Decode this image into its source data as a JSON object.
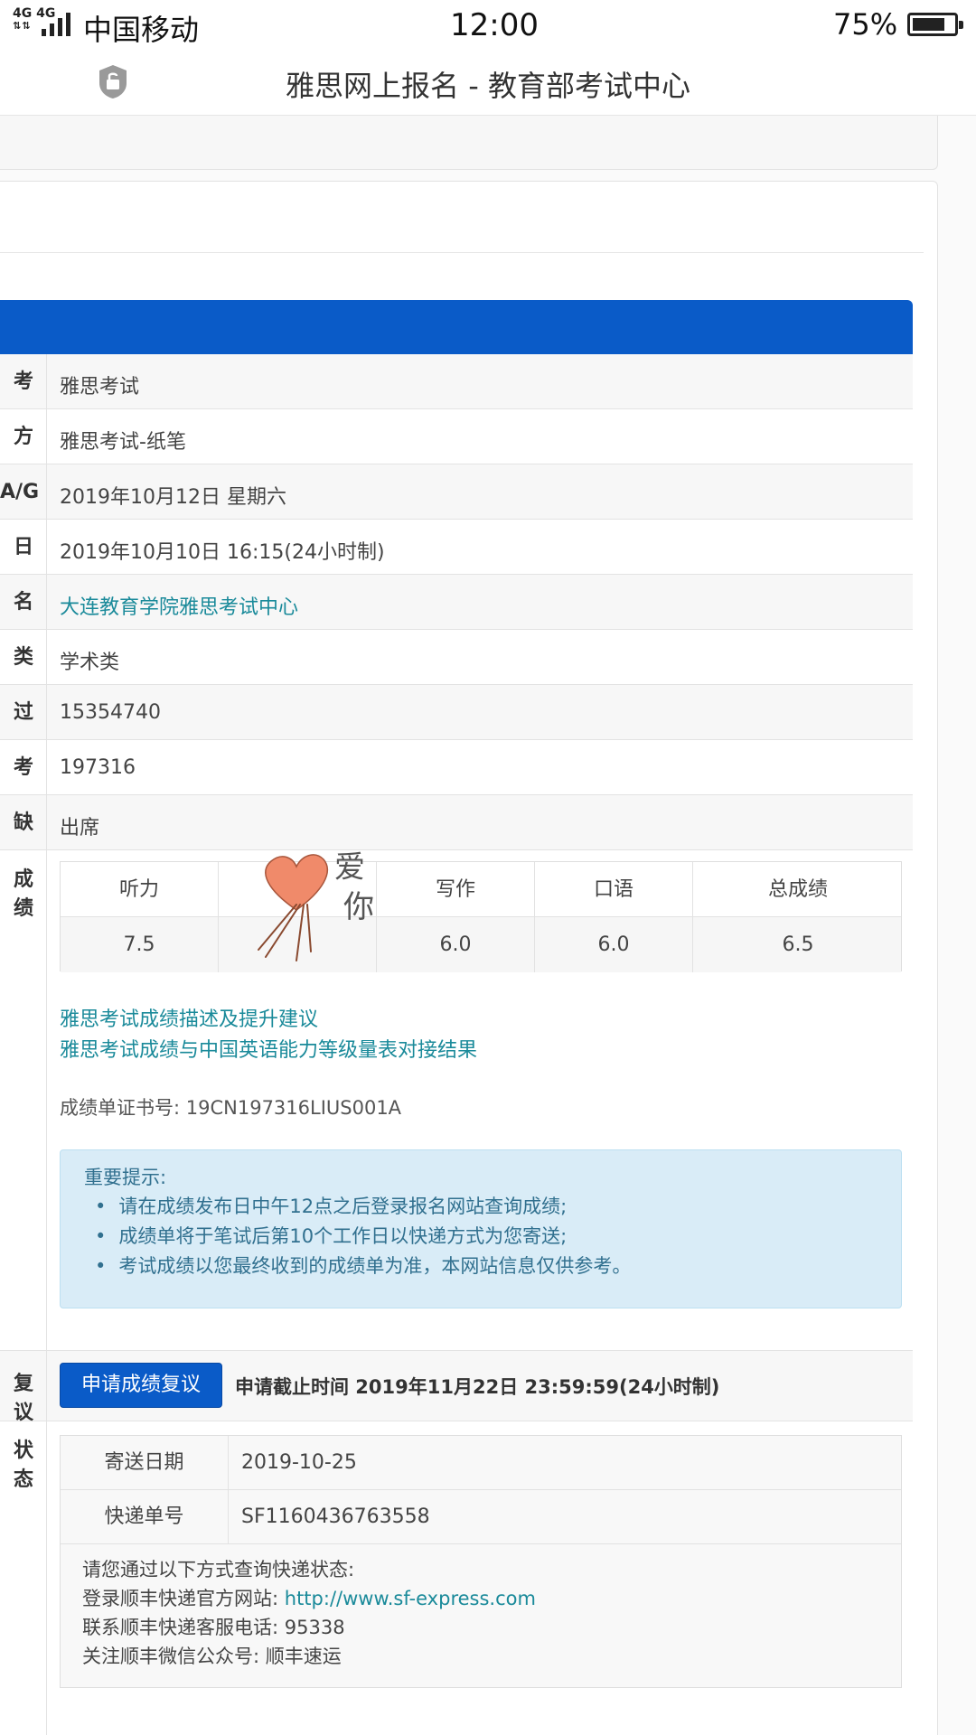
{
  "status_bar": {
    "network": "4G 4G",
    "carrier": "中国移动",
    "time": "12:00",
    "battery": "75%"
  },
  "nav": {
    "title": "雅思网上报名 - 教育部考试中心",
    "lock_icon": "lock-icon"
  },
  "details": [
    {
      "label": "考试",
      "value": "雅思考试"
    },
    {
      "label": "方式",
      "value": "雅思考试-纸笔"
    },
    {
      "label": "A/G",
      "value": "2019年10月12日 星期六"
    },
    {
      "label": "日期",
      "value": "2019年10月10日 16:15(24小时制)"
    },
    {
      "label": "名称",
      "value": "大连教育学院雅思考试中心"
    },
    {
      "label": "类型",
      "value": "学术类"
    },
    {
      "label": "过程)",
      "value": "15354740"
    },
    {
      "label": "考号",
      "value": "197316"
    },
    {
      "label": "缺席",
      "value": "出席"
    }
  ],
  "scores": {
    "label": "成绩",
    "headers": [
      "听力",
      "",
      "写作",
      "口语",
      "总成绩"
    ],
    "values": [
      "7.5",
      "",
      "6.0",
      "6.0",
      "6.5"
    ],
    "sticker_text": [
      "爱",
      "你"
    ]
  },
  "links": [
    "雅思考试成绩描述及提升建议",
    "雅思考试成绩与中国英语能力等级量表对接结果"
  ],
  "certificate": "成绩单证书号: 19CN197316LIUS001A",
  "notice": {
    "title": "重要提示:",
    "items": [
      "请在成绩发布日中午12点之后登录报名网站查询成绩;",
      "成绩单将于笔试后第10个工作日以快递方式为您寄送;",
      "考试成绩以您最终收到的成绩单为准，本网站信息仅供参考。"
    ]
  },
  "review": {
    "label": "复议",
    "button": "申请成绩复议",
    "deadline": "申请截止时间 2019年11月22日 23:59:59(24小时制)"
  },
  "delivery": {
    "label": "状态",
    "rows": [
      {
        "key": "寄送日期",
        "value": "2019-10-25"
      },
      {
        "key": "快递单号",
        "value": "SF1160436763558"
      }
    ],
    "info_title": "请您通过以下方式查询快递状态:",
    "info_site_label": "登录顺丰快递官方网站:",
    "info_site_url": "http://www.sf-express.com",
    "info_phone": "联系顺丰快递客服电话: 95338",
    "info_wechat": "关注顺丰微信公众号: 顺丰速运"
  },
  "colors": {
    "primary_blue": "#0a5bc8",
    "link_teal": "#1a8a9a",
    "notice_bg": "#d9ecf7",
    "heart": "#f08a6a"
  }
}
